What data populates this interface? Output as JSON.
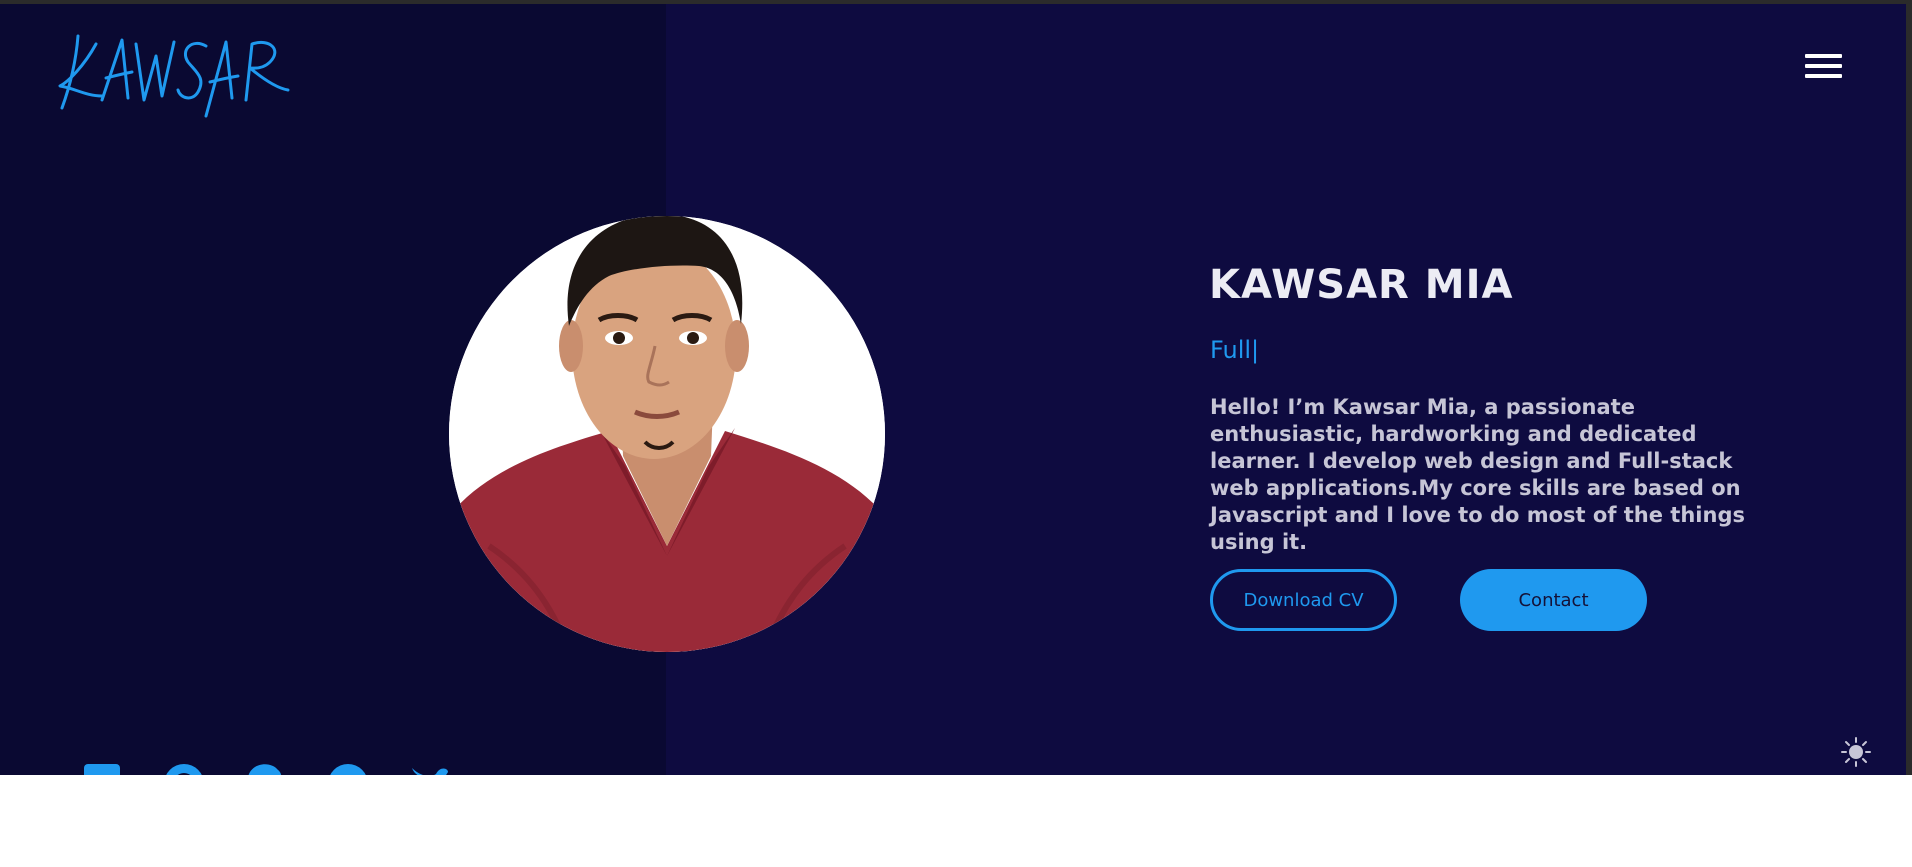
{
  "header": {
    "logo_text": "KAWSAR",
    "menu_icon": "hamburger-menu-icon"
  },
  "hero": {
    "name": "KAWSAR MIA",
    "typed_text": "Full|",
    "bio": "Hello! I’m Kawsar Mia, a passionate enthusiastic, hardworking and dedicated learner. I develop web design and Full-stack web applications.My core skills are based on Javascript and I love to do most of the things using it.",
    "download_cv_label": "Download CV",
    "contact_label": "Contact"
  },
  "socials": [
    "linkedin-icon",
    "github-icon",
    "codepen-icon",
    "facebook-icon",
    "twitter-icon"
  ],
  "theme_toggle_icon": "sun-icon",
  "colors": {
    "accent": "#1f99ef",
    "background": "#0e0b40",
    "left_panel": "#0a0932",
    "text_light": "#ececf4",
    "text_muted": "#c6c5d6"
  }
}
